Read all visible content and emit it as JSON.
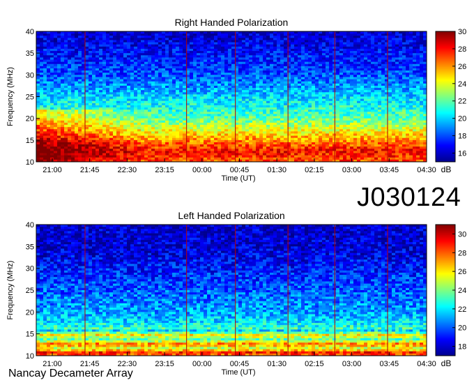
{
  "figure": {
    "id_label": "J030124",
    "credit": "Nancay Decameter Array"
  },
  "chart_data": [
    {
      "type": "heatmap",
      "title": "Right Handed Polarization",
      "xlabel": "Time (UT)",
      "ylabel": "Frequency (MHz)",
      "x_ticks": [
        "21:00",
        "21:45",
        "22:30",
        "23:15",
        "00:00",
        "00:45",
        "01:30",
        "02:15",
        "03:00",
        "03:45",
        "04:30"
      ],
      "ylim": [
        10,
        40
      ],
      "y_ticks": [
        10,
        15,
        20,
        25,
        30,
        35,
        40
      ],
      "colorbar": {
        "label": "dB",
        "range": [
          15,
          30
        ],
        "ticks": [
          16,
          18,
          20,
          22,
          24,
          26,
          28,
          30
        ]
      },
      "intensity_profile_db": [
        {
          "freq_mhz": 10,
          "db": 27
        },
        {
          "freq_mhz": 12.5,
          "db": 28
        },
        {
          "freq_mhz": 15,
          "db": 26
        },
        {
          "freq_mhz": 17.5,
          "db": 24
        },
        {
          "freq_mhz": 20,
          "db": 22
        },
        {
          "freq_mhz": 25,
          "db": 20
        },
        {
          "freq_mhz": 30,
          "db": 18
        },
        {
          "freq_mhz": 35,
          "db": 17
        },
        {
          "freq_mhz": 40,
          "db": 16
        }
      ]
    },
    {
      "type": "heatmap",
      "title": "Left Handed Polarization",
      "xlabel": "Time (UT)",
      "ylabel": "Frequency (MHz)",
      "x_ticks": [
        "21:00",
        "21:45",
        "22:30",
        "23:15",
        "00:00",
        "00:45",
        "01:30",
        "02:15",
        "03:00",
        "03:45",
        "04:30"
      ],
      "ylim": [
        10,
        40
      ],
      "y_ticks": [
        10,
        15,
        20,
        25,
        30,
        35,
        40
      ],
      "colorbar": {
        "label": "dB",
        "range": [
          17,
          31
        ],
        "ticks": [
          18,
          20,
          22,
          24,
          26,
          28,
          30
        ]
      },
      "intensity_profile_db": [
        {
          "freq_mhz": 10,
          "db": 28
        },
        {
          "freq_mhz": 12.5,
          "db": 26
        },
        {
          "freq_mhz": 15,
          "db": 24
        },
        {
          "freq_mhz": 17.5,
          "db": 22
        },
        {
          "freq_mhz": 20,
          "db": 21
        },
        {
          "freq_mhz": 25,
          "db": 20
        },
        {
          "freq_mhz": 30,
          "db": 19
        },
        {
          "freq_mhz": 35,
          "db": 18
        },
        {
          "freq_mhz": 40,
          "db": 18
        }
      ]
    }
  ]
}
